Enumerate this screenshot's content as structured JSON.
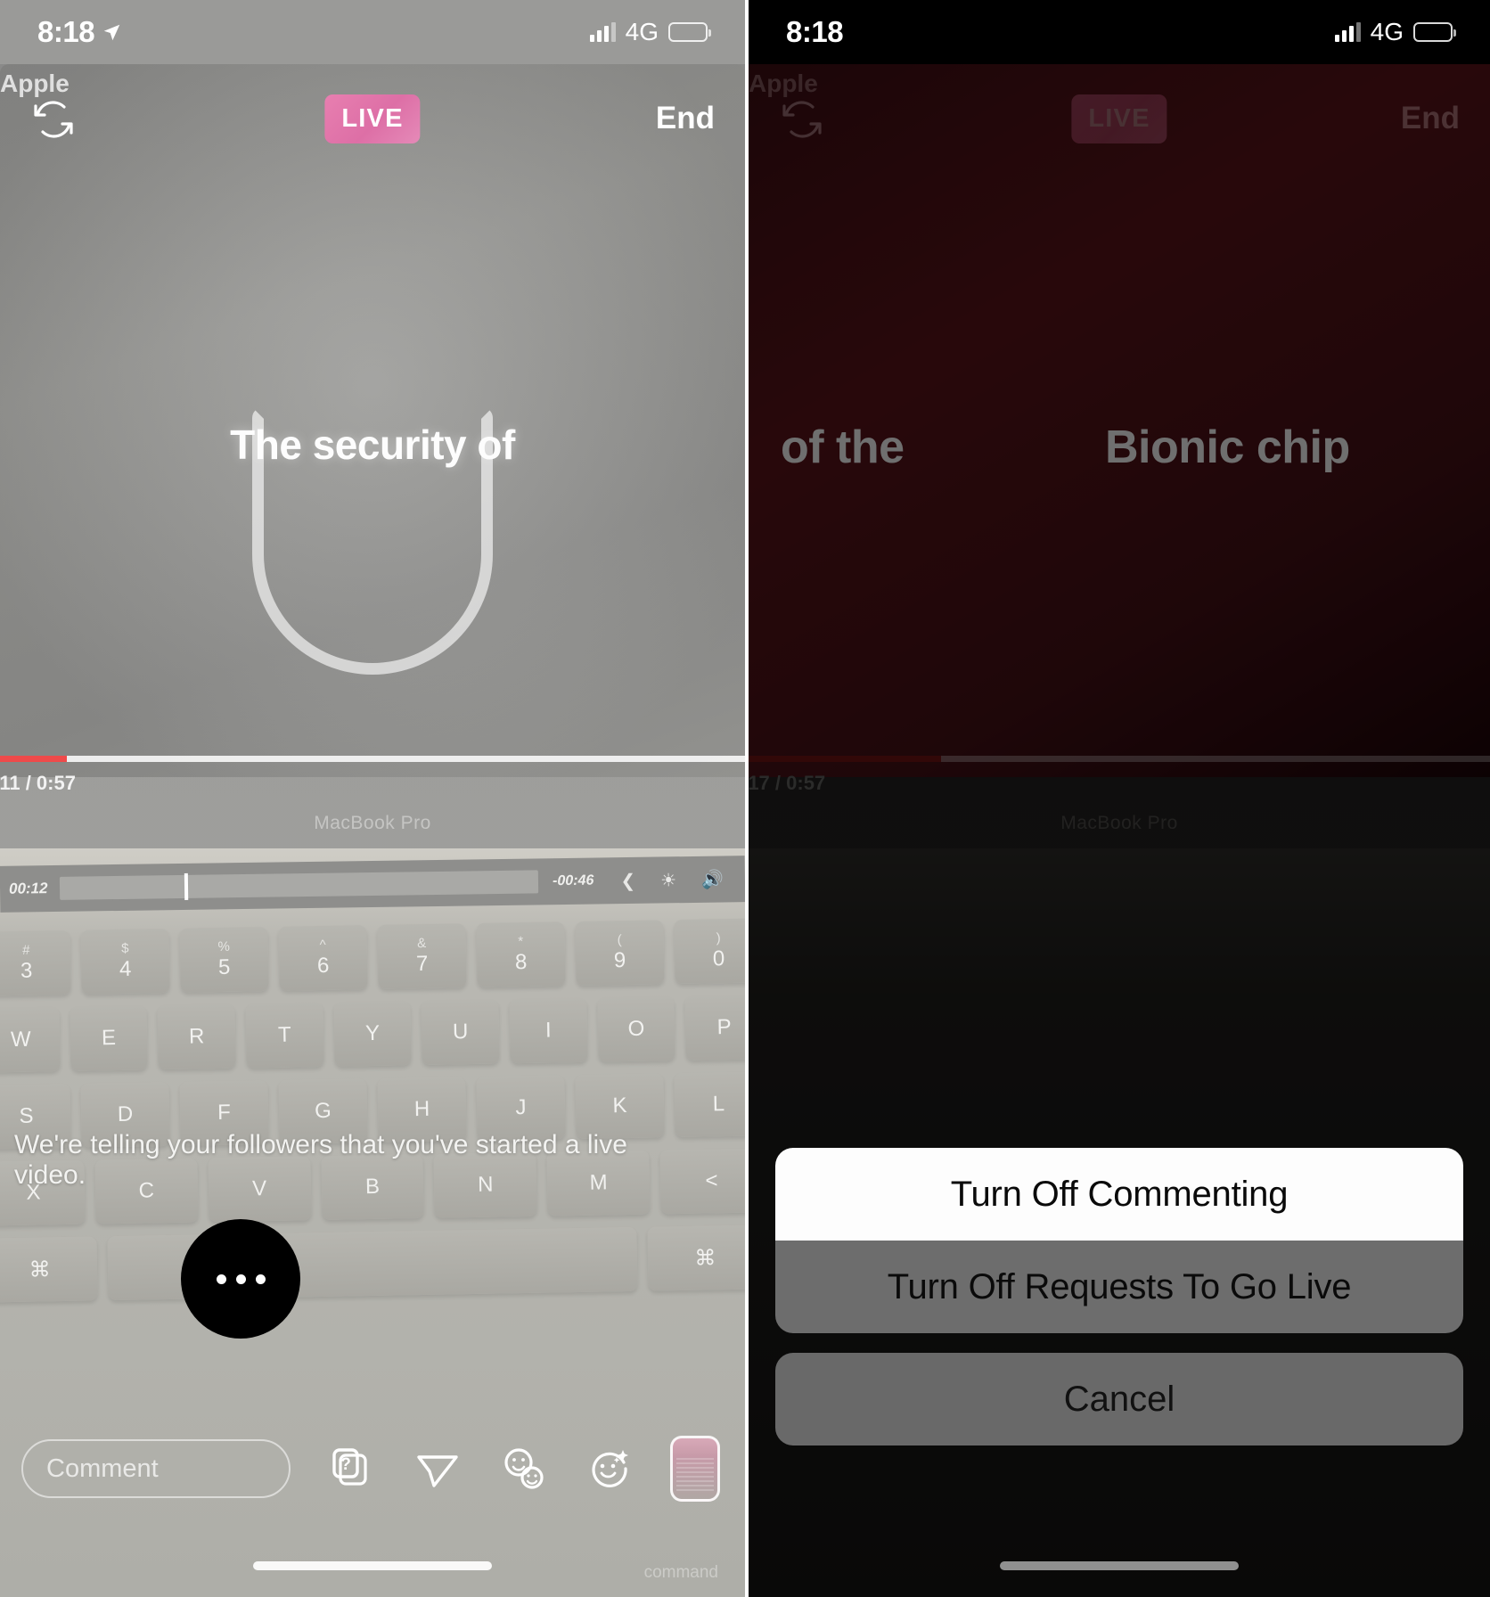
{
  "left_panel": {
    "status_bar": {
      "time": "8:18",
      "location_icon": "location-arrow-icon",
      "signal_icon": "cellular-bars-icon",
      "network": "4G",
      "battery_icon": "battery-icon"
    },
    "live_header": {
      "username_overlay": "Apple",
      "rotate_camera_icon": "rotate-camera-icon",
      "live_badge": "LIVE",
      "live_badge_color": "#e07fae",
      "end_label": "End"
    },
    "broadcast_video": {
      "slide_text": "The security of",
      "shield_icon": "shield-outline-icon",
      "video_time": ":11 / 0:57",
      "video_progress_percent": 9,
      "progress_color": "#ef4a4a",
      "device_label": "MacBook Pro",
      "touchbar": {
        "elapsed": "00:12",
        "remaining": "-00:46",
        "back_icon": "chevron-left-icon",
        "brightness_icon": "brightness-icon",
        "volume_icon": "volume-icon"
      },
      "keyboard": {
        "number_row": [
          {
            "sup": "#",
            "key": "3"
          },
          {
            "sup": "$",
            "key": "4"
          },
          {
            "sup": "%",
            "key": "5"
          },
          {
            "sup": "^",
            "key": "6"
          },
          {
            "sup": "&",
            "key": "7"
          },
          {
            "sup": "*",
            "key": "8"
          },
          {
            "sup": "(",
            "key": "9"
          },
          {
            "sup": ")",
            "key": "0"
          }
        ],
        "letter_row_1": [
          "W",
          "E",
          "R",
          "T",
          "Y",
          "U",
          "I",
          "O",
          "P"
        ],
        "letter_row_2": [
          "S",
          "D",
          "F",
          "G",
          "H",
          "J",
          "K",
          "L"
        ],
        "letter_row_3": [
          "X",
          "C",
          "V",
          "B",
          "N",
          "M",
          "<"
        ],
        "command_left": "⌘",
        "command_right": "⌘",
        "command_label": "command"
      }
    },
    "system_message": "We're telling your followers that you've started a live video.",
    "toolbar": {
      "comment_placeholder": "Comment",
      "more_options_icon": "ellipsis-icon",
      "question_sticker_icon": "question-sticker-icon",
      "share_icon": "paper-plane-icon",
      "add_guest_icon": "two-faces-icon",
      "effects_icon": "face-sparkles-icon",
      "preview_thumbnail_icon": "camera-preview-thumbnail"
    },
    "tap_indicator": {
      "target": "more-options-button",
      "glyph": "•••"
    },
    "home_indicator": "home-indicator"
  },
  "right_panel": {
    "status_bar": {
      "time": "8:18",
      "signal_icon": "cellular-bars-icon",
      "network": "4G",
      "battery_icon": "battery-icon"
    },
    "live_header": {
      "username_overlay": "Apple",
      "rotate_camera_icon": "rotate-camera-icon",
      "live_badge": "LIVE",
      "end_label": "End"
    },
    "broadcast_video": {
      "slide_text_left": "of the",
      "slide_text_right": "Bionic chip",
      "video_time": ":17 / 0:57",
      "video_progress_percent": 26,
      "device_label": "MacBook Pro"
    },
    "action_sheet": {
      "options": [
        {
          "label": "Turn Off Commenting",
          "state": "pressed"
        },
        {
          "label": "Turn Off Requests To Go Live",
          "state": "normal"
        }
      ],
      "cancel_label": "Cancel"
    },
    "home_indicator": "home-indicator"
  }
}
